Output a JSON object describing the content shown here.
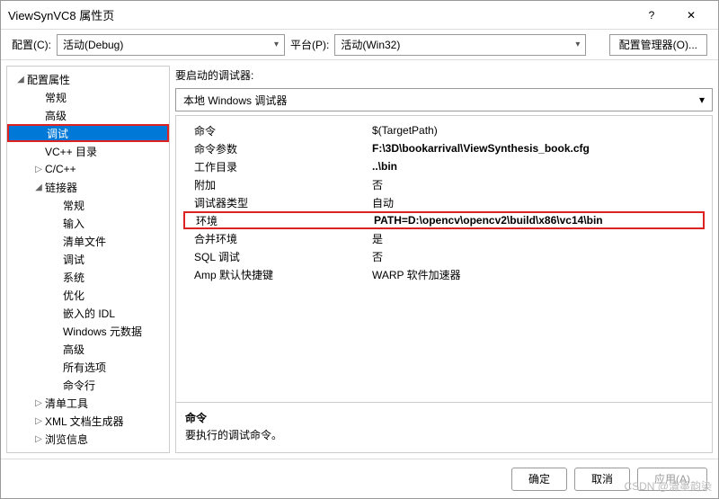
{
  "title": "ViewSynVC8 属性页",
  "toolbar": {
    "config_label": "配置(C):",
    "config_value": "活动(Debug)",
    "platform_label": "平台(P):",
    "platform_value": "活动(Win32)",
    "manager_label": "配置管理器(O)..."
  },
  "tree": [
    {
      "label": "配置属性",
      "depth": 1,
      "expand": "▢",
      "sel": false
    },
    {
      "label": "常规",
      "depth": 2,
      "expand": "",
      "sel": false
    },
    {
      "label": "高级",
      "depth": 2,
      "expand": "",
      "sel": false
    },
    {
      "label": "调试",
      "depth": 2,
      "expand": "",
      "sel": true
    },
    {
      "label": "VC++ 目录",
      "depth": 2,
      "expand": "",
      "sel": false
    },
    {
      "label": "C/C++",
      "depth": 2,
      "expand": "▷",
      "sel": false
    },
    {
      "label": "链接器",
      "depth": 2,
      "expand": "▢",
      "sel": false
    },
    {
      "label": "常规",
      "depth": 3,
      "expand": "",
      "sel": false
    },
    {
      "label": "输入",
      "depth": 3,
      "expand": "",
      "sel": false
    },
    {
      "label": "清单文件",
      "depth": 3,
      "expand": "",
      "sel": false
    },
    {
      "label": "调试",
      "depth": 3,
      "expand": "",
      "sel": false
    },
    {
      "label": "系统",
      "depth": 3,
      "expand": "",
      "sel": false
    },
    {
      "label": "优化",
      "depth": 3,
      "expand": "",
      "sel": false
    },
    {
      "label": "嵌入的 IDL",
      "depth": 3,
      "expand": "",
      "sel": false
    },
    {
      "label": "Windows 元数据",
      "depth": 3,
      "expand": "",
      "sel": false
    },
    {
      "label": "高级",
      "depth": 3,
      "expand": "",
      "sel": false
    },
    {
      "label": "所有选项",
      "depth": 3,
      "expand": "",
      "sel": false
    },
    {
      "label": "命令行",
      "depth": 3,
      "expand": "",
      "sel": false
    },
    {
      "label": "清单工具",
      "depth": 2,
      "expand": "▷",
      "sel": false
    },
    {
      "label": "XML 文档生成器",
      "depth": 2,
      "expand": "▷",
      "sel": false
    },
    {
      "label": "浏览信息",
      "depth": 2,
      "expand": "▷",
      "sel": false
    }
  ],
  "content": {
    "launch_label": "要启动的调试器:",
    "debugger_value": "本地 Windows 调试器",
    "rows": [
      {
        "key": "命令",
        "val": "$(TargetPath)",
        "bold": false,
        "hl": false
      },
      {
        "key": "命令参数",
        "val": "F:\\3D\\bookarrival\\ViewSynthesis_book.cfg",
        "bold": true,
        "hl": false
      },
      {
        "key": "工作目录",
        "val": "..\\bin",
        "bold": true,
        "hl": false
      },
      {
        "key": "附加",
        "val": "否",
        "bold": false,
        "hl": false
      },
      {
        "key": "调试器类型",
        "val": "自动",
        "bold": false,
        "hl": false
      },
      {
        "key": "环境",
        "val": "PATH=D:\\opencv\\opencv2\\build\\x86\\vc14\\bin",
        "bold": true,
        "hl": true
      },
      {
        "key": "合并环境",
        "val": "是",
        "bold": false,
        "hl": false
      },
      {
        "key": "SQL 调试",
        "val": "否",
        "bold": false,
        "hl": false
      },
      {
        "key": "Amp 默认快捷键",
        "val": "WARP 软件加速器",
        "bold": false,
        "hl": false
      }
    ],
    "desc_title": "命令",
    "desc_text": "要执行的调试命令。"
  },
  "footer": {
    "ok": "确定",
    "cancel": "取消",
    "apply": "应用(A)"
  },
  "watermark": "CSDN @清墨韵染"
}
